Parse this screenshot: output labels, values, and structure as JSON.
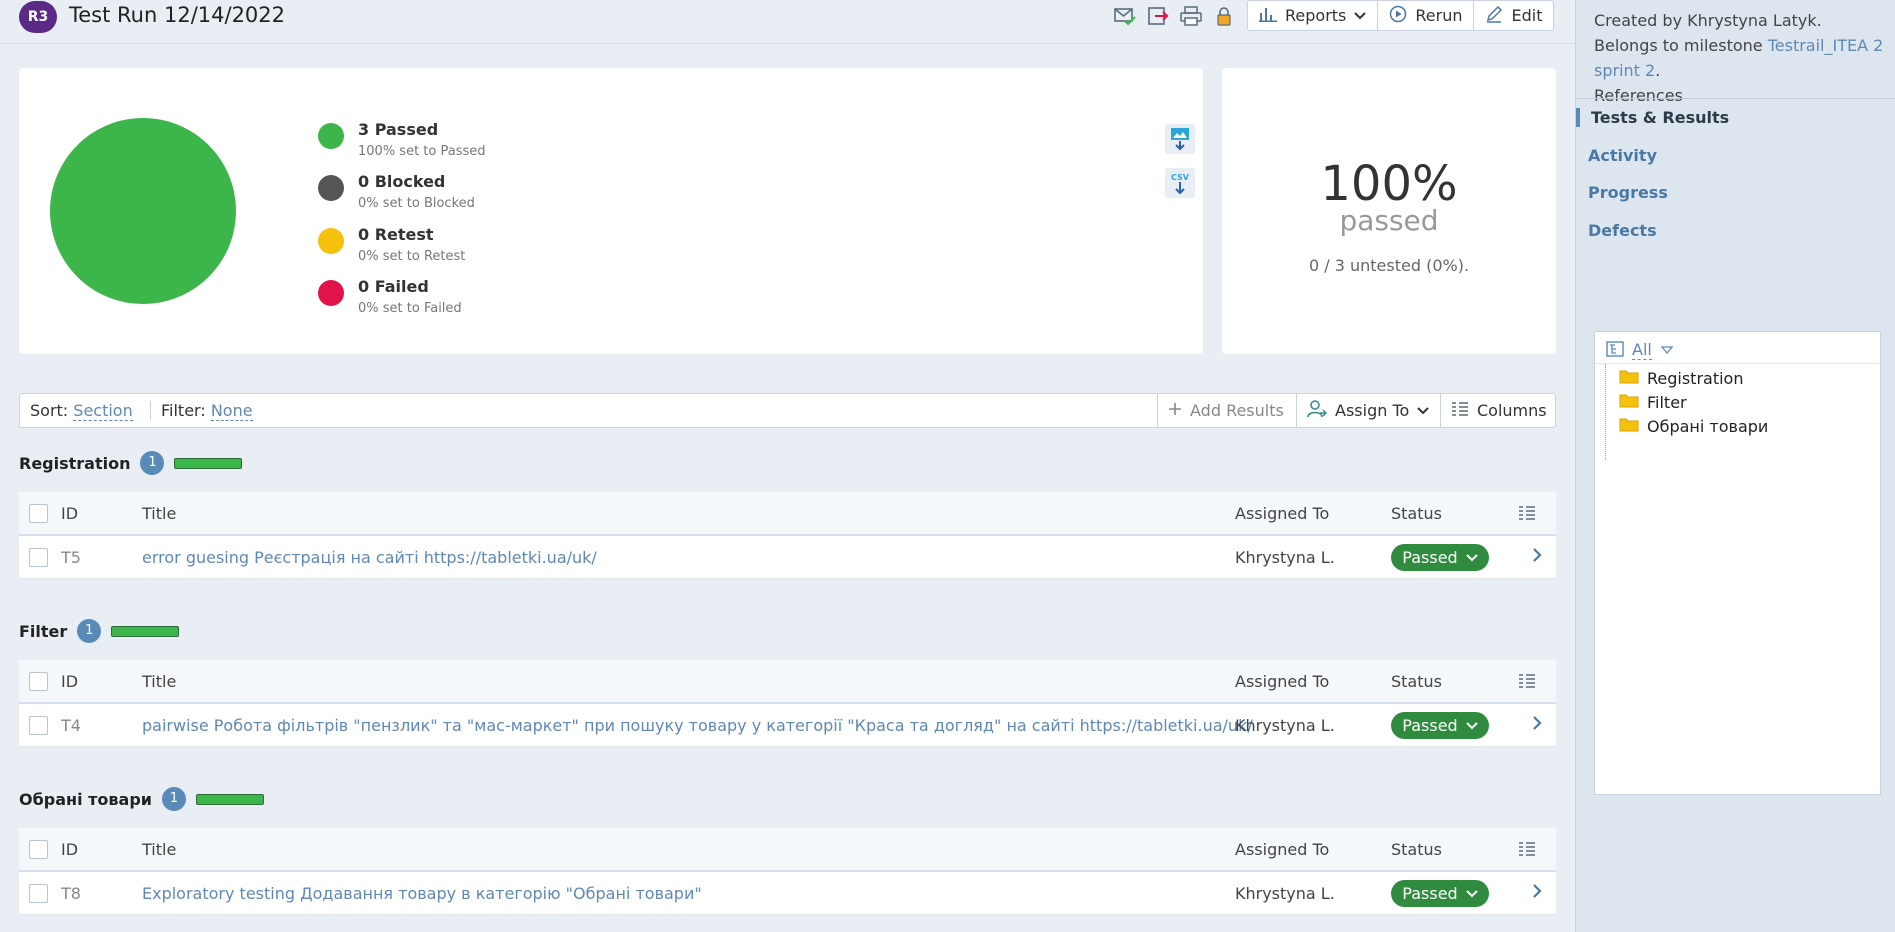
{
  "header": {
    "run_badge": "R3",
    "title": "Test Run 12/14/2022",
    "icons": [
      "email-check-icon",
      "export-icon",
      "print-icon",
      "lock-icon"
    ],
    "buttons": {
      "reports": "Reports",
      "rerun": "Rerun",
      "edit": "Edit"
    }
  },
  "summary": {
    "legend": [
      {
        "label": "3 Passed",
        "sub": "100% set to Passed",
        "color": "#3cb54a"
      },
      {
        "label": "0 Blocked",
        "sub": "0% set to Blocked",
        "color": "#555555"
      },
      {
        "label": "0 Retest",
        "sub": "0% set to Retest",
        "color": "#f4c20d"
      },
      {
        "label": "0 Failed",
        "sub": "0% set to Failed",
        "color": "#e0134a"
      }
    ],
    "pie_color": "#3cb54a",
    "percent": "100%",
    "percent_label": "passed",
    "untested": "0 / 3 untested (0%).",
    "download_csv": "CSV"
  },
  "toolbar": {
    "sort_label": "Sort:",
    "sort_value": "Section",
    "filter_label": "Filter:",
    "filter_value": "None",
    "add_results": "Add Results",
    "assign_to": "Assign To",
    "columns": "Columns"
  },
  "table_headers": {
    "id": "ID",
    "title": "Title",
    "assigned": "Assigned To",
    "status": "Status"
  },
  "sections": [
    {
      "name": "Registration",
      "count": "1",
      "progress": 1.0,
      "rows": [
        {
          "id": "T5",
          "title": "error guesing Реєстрація на сайті https://tabletki.ua/uk/",
          "assigned": "Khrystyna L.",
          "status": "Passed"
        }
      ]
    },
    {
      "name": "Filter",
      "count": "1",
      "progress": 1.0,
      "rows": [
        {
          "id": "T4",
          "title": "pairwise Робота фільтрів \"пензлик\" та \"мас-маркет\" при пошуку товару у категорії \"Краса та догляд\" на сайті https://tabletki.ua/uk/",
          "assigned": "Khrystyna L.",
          "status": "Passed"
        }
      ]
    },
    {
      "name": "Обрані товари",
      "count": "1",
      "progress": 1.0,
      "rows": [
        {
          "id": "T8",
          "title": "Exploratory testing Додавання товару в категорію \"Обрані товари\"",
          "assigned": "Khrystyna L.",
          "status": "Passed"
        }
      ]
    }
  ],
  "sidebar": {
    "info_prefix": "Created by Khrystyna Latyk. Belongs to milestone ",
    "milestone": "Testrail_ITEA 2 sprint 2",
    "info_suffix": ".",
    "references": "References",
    "nav": [
      "Tests & Results",
      "Activity",
      "Progress",
      "Defects"
    ],
    "tree_filter": "All",
    "tree": [
      "Registration",
      "Filter",
      "Обрані товари"
    ]
  }
}
